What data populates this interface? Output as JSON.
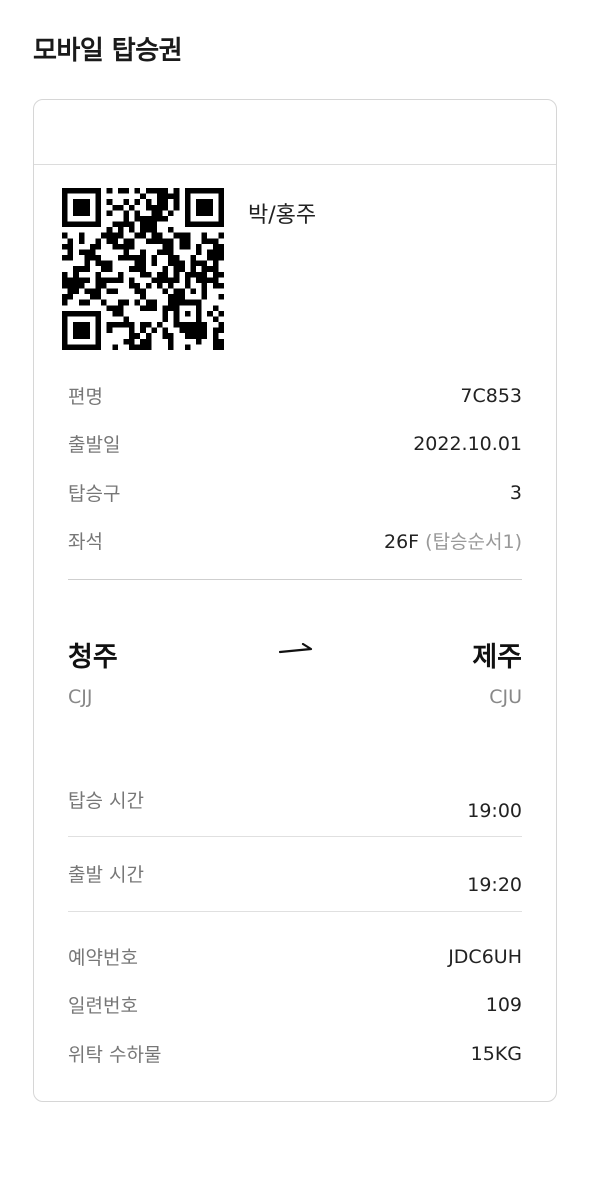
{
  "header": {
    "title": "모바일 탑승권"
  },
  "passenger": {
    "name": "박/홍주"
  },
  "flight_info": [
    {
      "label": "편명",
      "value": "7C853"
    },
    {
      "label": "출발일",
      "value": "2022.10.01"
    },
    {
      "label": "탑승구",
      "value": "3"
    },
    {
      "label": "좌석",
      "value": "26F",
      "sub": "(탑승순서1)"
    }
  ],
  "route": {
    "origin_city": "청주",
    "origin_code": "CJJ",
    "dest_city": "제주",
    "dest_code": "CJU"
  },
  "times": [
    {
      "label": "탑승 시간",
      "value": "19:00"
    },
    {
      "label": "출발 시간",
      "value": "19:20"
    }
  ],
  "booking": [
    {
      "label": "예약번호",
      "value": "JDC6UH"
    },
    {
      "label": "일련번호",
      "value": "109"
    },
    {
      "label": "위탁 수하물",
      "value": "15KG"
    }
  ],
  "icons": {
    "qr": "qr-code-icon",
    "arrow": "route-arrow-icon"
  }
}
